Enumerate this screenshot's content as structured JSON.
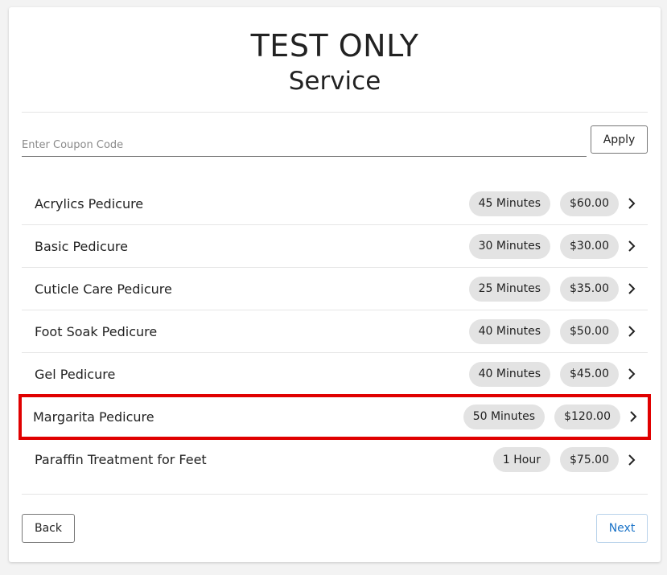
{
  "header": {
    "title": "TEST ONLY",
    "subtitle": "Service"
  },
  "coupon": {
    "placeholder": "Enter Coupon Code",
    "value": "",
    "apply_label": "Apply"
  },
  "services": [
    {
      "name": "Acrylics Pedicure",
      "duration": "45 Minutes",
      "price": "$60.00",
      "highlighted": false
    },
    {
      "name": "Basic Pedicure",
      "duration": "30 Minutes",
      "price": "$30.00",
      "highlighted": false
    },
    {
      "name": "Cuticle Care Pedicure",
      "duration": "25 Minutes",
      "price": "$35.00",
      "highlighted": false
    },
    {
      "name": "Foot Soak Pedicure",
      "duration": "40 Minutes",
      "price": "$50.00",
      "highlighted": false
    },
    {
      "name": "Gel Pedicure",
      "duration": "40 Minutes",
      "price": "$45.00",
      "highlighted": false
    },
    {
      "name": "Margarita Pedicure",
      "duration": "50 Minutes",
      "price": "$120.00",
      "highlighted": true
    },
    {
      "name": "Paraffin Treatment for Feet",
      "duration": "1 Hour",
      "price": "$75.00",
      "highlighted": false
    }
  ],
  "footer": {
    "back_label": "Back",
    "next_label": "Next"
  },
  "colors": {
    "highlight": "#e00000",
    "next_text": "#1a73c8",
    "pill_bg": "#e3e3e3"
  },
  "icons": {
    "row_chevron": "chevron-right-icon"
  }
}
